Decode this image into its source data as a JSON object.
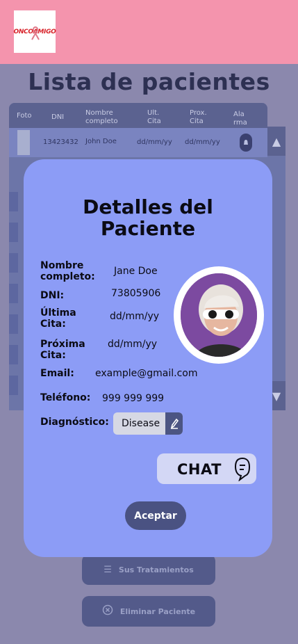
{
  "header": {
    "logo_text": "ONCOAMIGO"
  },
  "page": {
    "title": "Lista de pacientes"
  },
  "table": {
    "headers": [
      "Foto",
      "DNI",
      "Nombre completo",
      "Ult. Cita",
      "Prox. Cita",
      "Alarma"
    ],
    "header_lines": {
      "foto": "Foto",
      "dni": "DNI",
      "nombre_1": "Nombre",
      "nombre_2": "completo",
      "ult_1": "Ult.",
      "ult_2": "Cita",
      "prox_1": "Prox.",
      "prox_2": "Cita",
      "alarma_1": "Ala",
      "alarma_2": "rma"
    },
    "rows": [
      {
        "dni": "13423432",
        "name": "John Doe",
        "last_visit": "dd/mm/yy",
        "next_visit": "dd/mm/yy"
      }
    ]
  },
  "buttons": {
    "treatments": "Sus Tratamientos",
    "delete_patient": "Eliminar Paciente"
  },
  "modal": {
    "title_line1": "Detalles del",
    "title_line2": "Paciente",
    "labels": {
      "name_1": "Nombre",
      "name_2": "completo:",
      "dni": "DNI:",
      "last_1": "Última",
      "last_2": "Cita:",
      "next_1": "Próxima",
      "next_2": "Cita:",
      "email": "Email:",
      "phone": "Teléfono:",
      "diagnosis": "Diagnóstico:"
    },
    "values": {
      "name": "Jane Doe",
      "dni": "73805906",
      "last_visit": "dd/mm/yy",
      "next_visit": "dd/mm/yy",
      "email": "example@gmail.com",
      "phone": "999 999 999",
      "diagnosis": "Disease"
    },
    "chat_label": "CHAT",
    "accept_label": "Aceptar"
  },
  "icons": {
    "logo": "ribbon-logo-icon",
    "alarm": "bell-icon",
    "scroll_up": "triangle-up-icon",
    "scroll_down": "triangle-down-icon",
    "treatments": "list-icon",
    "delete": "circle-x-icon",
    "edit": "pencil-icon",
    "chat": "chat-bubble-icon"
  },
  "colors": {
    "header": "#f494ad",
    "modal": "#8c9cf6",
    "accent": "#4a5282"
  }
}
